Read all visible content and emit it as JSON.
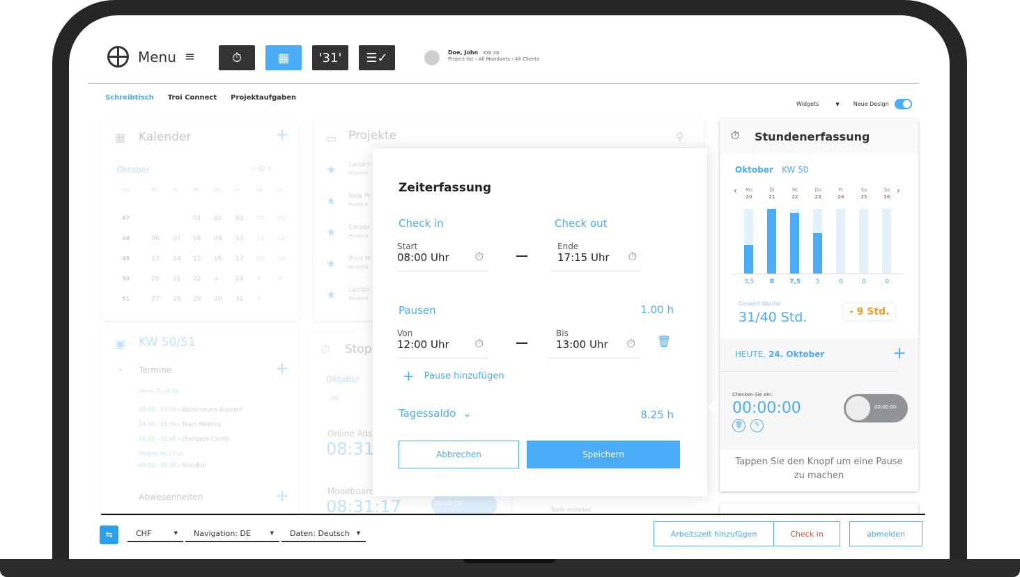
{
  "header": {
    "menu_label": "Menu",
    "user_name": "Doe, John",
    "week": "KW 38",
    "breadcrumb": "Project list › All Mandants › All Clients",
    "calendar_button": "'31'"
  },
  "nav": {
    "tabs": [
      "Schreibtisch",
      "Troi Connect",
      "Projektaufgaben"
    ],
    "widgets_label": "Widgets",
    "new_design_label": "Neue Design",
    "new_design_on": true
  },
  "kalender": {
    "title": "Kalender",
    "month": "Oktober",
    "headers": [
      "KW",
      "Mo",
      "Di",
      "Mi",
      "Do",
      "Fr",
      "Sa",
      "So"
    ],
    "rows": [
      [
        "47",
        "",
        "",
        "01",
        "02",
        "03",
        "04",
        "05"
      ],
      [
        "48",
        "06",
        "07",
        "08",
        "09",
        "10",
        "11",
        "12"
      ],
      [
        "49",
        "13",
        "14",
        "15",
        "16",
        "17",
        "18",
        "19"
      ],
      [
        "50",
        "20",
        "21",
        "22",
        "+",
        "24",
        "☀",
        "☀"
      ],
      [
        "51",
        "27",
        "28",
        "29",
        "30",
        "31",
        "☀",
        ""
      ]
    ]
  },
  "kw": {
    "title": "KW 50/51",
    "termine": "Termine",
    "today": "Heute, Di. 16.10",
    "tomorrow": "Morgen, Mi. 17.10",
    "events": [
      {
        "time": "10.00 - 11:00",
        "name": "› Abstimmung Angebot"
      },
      {
        "time": "14.00 - 15:00",
        "name": "› Team Meeting"
      },
      {
        "time": "16.15 - 16:45",
        "name": "› Übergabe Carola"
      }
    ],
    "events_tomorrow": [
      {
        "time": "09.00 - 09:30",
        "name": "› StandUp"
      }
    ],
    "abwesenheiten": "Abwesenheiten"
  },
  "projekte": {
    "title": "Projekte",
    "items": [
      {
        "name": "Landin",
        "sub": "Musterk"
      },
      {
        "name": "New Pr",
        "sub": "Musterk"
      },
      {
        "name": "Corpor",
        "sub": "Musterk"
      },
      {
        "name": "Print M",
        "sub": "Musterk"
      },
      {
        "name": "Landin",
        "sub": "Musterk"
      }
    ]
  },
  "stop": {
    "title": "Stop",
    "month": "Oktober",
    "day": "20",
    "item1": "Online Ads",
    "time1": "08:31",
    "item2": "Moodboard",
    "time2": "08:31:17",
    "pill": "00:00:02",
    "texte": "Texte erstellen"
  },
  "dialog": {
    "title": "Zeiterfassung",
    "checkin": "Check in",
    "checkout": "Check out",
    "start_label": "Start",
    "start": "08:00 Uhr",
    "end_label": "Ende",
    "end": "17:15 Uhr",
    "pausen": "Pausen",
    "pausen_total": "1.00 h",
    "von_label": "Von",
    "von": "12:00 Uhr",
    "bis_label": "Bis",
    "bis": "13:00 Uhr",
    "add_pause": "Pause hinzufügen",
    "saldo": "Tagessaldo",
    "saldo_value": "8.25 h",
    "cancel": "Abbrechen",
    "save": "Speichern"
  },
  "stunden": {
    "title": "Stundenerfassung",
    "month": "Oktober",
    "week": "KW 50",
    "days": [
      {
        "d": "Mo",
        "n": "20",
        "v": "3,5"
      },
      {
        "d": "Di",
        "n": "21",
        "v": "8"
      },
      {
        "d": "Mi",
        "n": "22",
        "v": "7,5"
      },
      {
        "d": "Do",
        "n": "23",
        "v": "5"
      },
      {
        "d": "Fr",
        "n": "24",
        "v": "0"
      },
      {
        "d": "Sa",
        "n": "25",
        "v": "0"
      },
      {
        "d": "So",
        "n": "26",
        "v": "0"
      }
    ],
    "total_label": "Gesamt Woche",
    "total": "31/40 Std.",
    "diff": "- 9 Std.",
    "today_prefix": "HEUTE,",
    "today_date": "24. Oktober",
    "checkin_label": "Checken Sie ein:",
    "timer": "00:00:00",
    "toggle_timer": "00:00:00",
    "hint": "Tappen Sie den Knopf um eine Pause zu machen"
  },
  "chart_data": {
    "type": "bar",
    "categories": [
      "Mo 20",
      "Di 21",
      "Mi 22",
      "Do 23",
      "Fr 24",
      "Sa 25",
      "So 26"
    ],
    "values": [
      3.5,
      8,
      7.5,
      5,
      0,
      0,
      0
    ],
    "ylim": [
      0,
      8
    ]
  },
  "footer": {
    "currency": "CHF",
    "navigation": "Navigation: DE",
    "daten": "Daten: Deutsch",
    "add_time": "Arbeitszeit hinzufügen",
    "checkin": "Check in",
    "logout": "abmelden"
  },
  "colors": {
    "accent": "#4aabf7",
    "warning": "#f39c29",
    "dark": "#333333",
    "checkin_red": "#d9482b"
  }
}
